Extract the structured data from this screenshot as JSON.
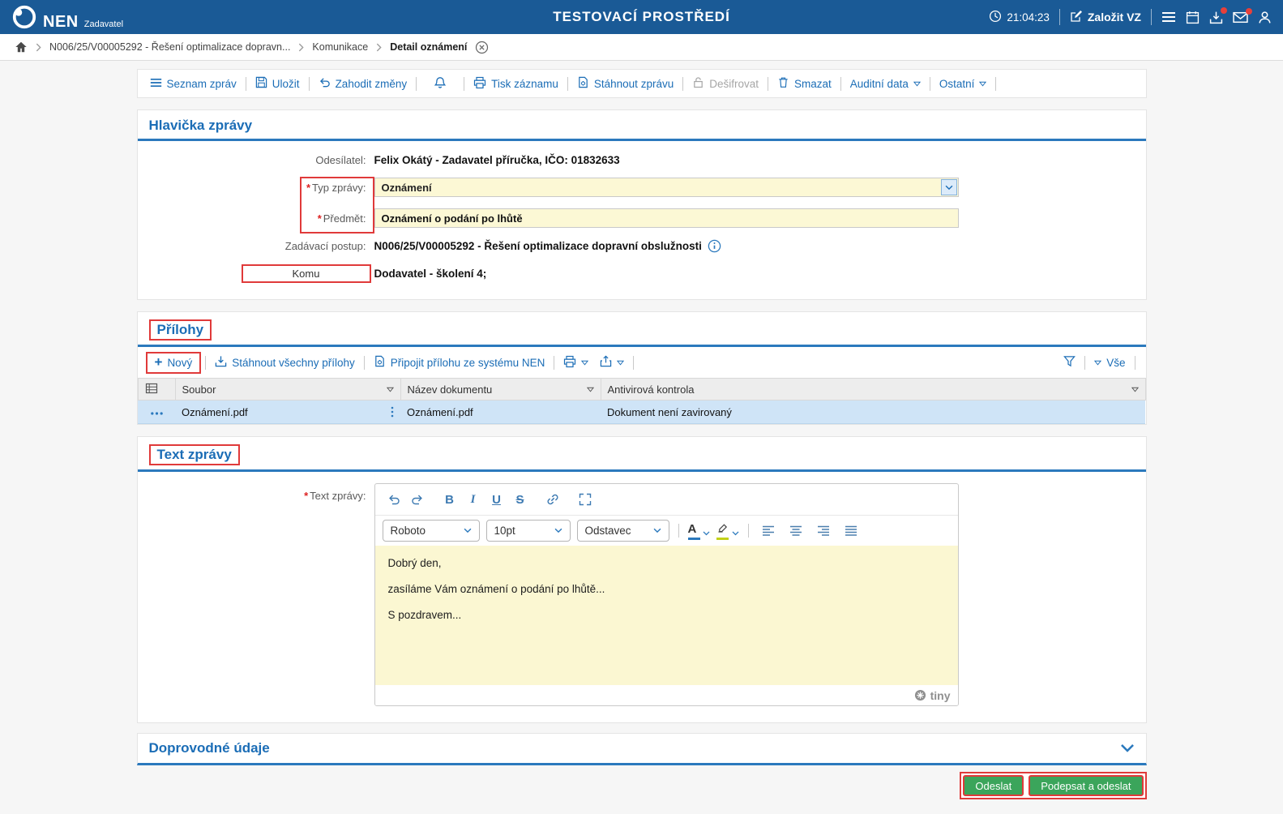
{
  "colors": {
    "header-bg": "#1a5a96",
    "accent": "#1b6db6",
    "accent-strong": "#2b79bd",
    "red": "#e03a3a",
    "green": "#3ba55b",
    "field-yellow": "#fcf8d5",
    "row-selected": "#cfe4f7",
    "badge": "#e8403a"
  },
  "header": {
    "brand": "NEN",
    "brand_sub": "Zadavatel",
    "title": "TESTOVACÍ PROSTŘEDÍ",
    "time": "21:04:23",
    "create_vz": "Založit VZ"
  },
  "breadcrumb": {
    "items": [
      "N006/25/V00005292 - Řešení optimalizace dopravn...",
      "Komunikace",
      "Detail oznámení"
    ]
  },
  "toolbar": {
    "seznam_zprav": "Seznam zpráv",
    "ulozit": "Uložit",
    "zahodit_zmeny": "Zahodit změny",
    "tisk_zaznamu": "Tisk záznamu",
    "stahnout_zpravu": "Stáhnout zprávu",
    "desifrovat": "Dešifrovat",
    "smazat": "Smazat",
    "auditni_data": "Auditní data",
    "ostatni": "Ostatní"
  },
  "required_mark": "*",
  "hlavicka": {
    "title": "Hlavička zprávy",
    "odesilatel_label": "Odesílatel:",
    "odesilatel_value": "Felix Okátý - Zadavatel příručka, IČO: 01832633",
    "typ_label": "Typ zprávy:",
    "typ_value": "Oznámení",
    "predmet_label": "Předmět:",
    "predmet_value": "Oznámení o podání po lhůtě",
    "postup_label": "Zadávací postup:",
    "postup_value": "N006/25/V00005292 - Řešení optimalizace dopravní obslužnosti",
    "komu_label": "Komu",
    "komu_value": "Dodavatel - školení 4;"
  },
  "prilohy": {
    "title": "Přílohy",
    "novy": "Nový",
    "stahnout_vse": "Stáhnout všechny přílohy",
    "pripojit": "Připojit přílohu ze systému NEN",
    "vse": "Vše",
    "columns": {
      "soubor": "Soubor",
      "nazev": "Název dokumentu",
      "antivir": "Antivirová kontrola"
    },
    "row": {
      "soubor": "Oznámení.pdf",
      "nazev": "Oznámení.pdf",
      "antivir": "Dokument není zavirovaný"
    }
  },
  "text_zpravy": {
    "title": "Text zprávy",
    "label": "Text zprávy:",
    "editor": {
      "font": "Roboto",
      "size": "10pt",
      "block": "Odstavec",
      "lines": [
        "Dobrý den,",
        "zasíláme Vám oznámení o podání po lhůtě...",
        "S pozdravem..."
      ],
      "brand": "tiny"
    }
  },
  "doprovodne": {
    "title": "Doprovodné údaje"
  },
  "footer": {
    "odeslat": "Odeslat",
    "podepsat": "Podepsat a odeslat"
  },
  "icons": {
    "clock-icon": "◷",
    "edit-icon": "✎",
    "menu-icon": "☰",
    "calendar-icon": "▦",
    "download-tray-icon": "⭳",
    "mail-icon": "✉",
    "user-icon": "👤",
    "home-icon": "⌂",
    "chevron-right-icon": ">",
    "close-circle-icon": "⊗",
    "list-icon": "☰",
    "save-icon": "🖫",
    "undo-icon": "↶",
    "redo-icon": "↷",
    "bell-icon": "🔔",
    "printer-icon": "⎙",
    "document-gear-icon": "🗎",
    "lock-icon": "🔓",
    "delete-icon": "🗑",
    "caret-down-icon": "▽",
    "filter-icon": "▼",
    "share-icon": "⇧",
    "rows-icon": "▤",
    "row-menu-icon": "•••",
    "drag-dots-icon": "⋮",
    "link-icon": "🔗",
    "fullscreen-icon": "⛶",
    "chevron-down-icon": "⌄",
    "info-icon": "ⓘ",
    "align-left-icon": "≡",
    "align-center-icon": "≡",
    "align-right-icon": "≡",
    "align-justify-icon": "≡",
    "highlight-icon": "🖍",
    "plus-icon": "+",
    "tiny-logo": "⊛"
  }
}
